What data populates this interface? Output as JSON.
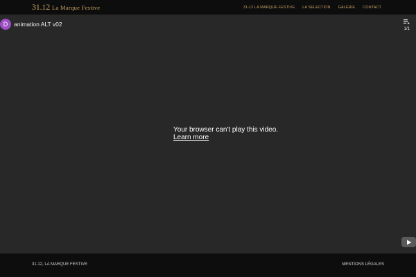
{
  "header": {
    "logo_number": "31.12",
    "logo_text": "La Marque Festive",
    "nav": [
      {
        "label": "31-12 LA MARQUE FESTIVE"
      },
      {
        "label": "LA SELECTION"
      },
      {
        "label": "GALERIE"
      },
      {
        "label": "CONTACT"
      }
    ]
  },
  "video": {
    "channel_initial": "D",
    "title": "animation ALT v02",
    "playlist_count": "1/1",
    "error_message": "Your browser can't play this video.",
    "learn_more": "Learn more"
  },
  "footer": {
    "copyright": "31.12, LA MARQUE FESTIVE",
    "legal": "MENTIONS LÉGALES"
  },
  "colors": {
    "accent": "#c9a262",
    "background": "#0d0d0d",
    "video_bg": "#282828",
    "avatar": "#9c4fc4"
  },
  "icons": [
    "playlist-icon",
    "youtube-logo-icon"
  ]
}
